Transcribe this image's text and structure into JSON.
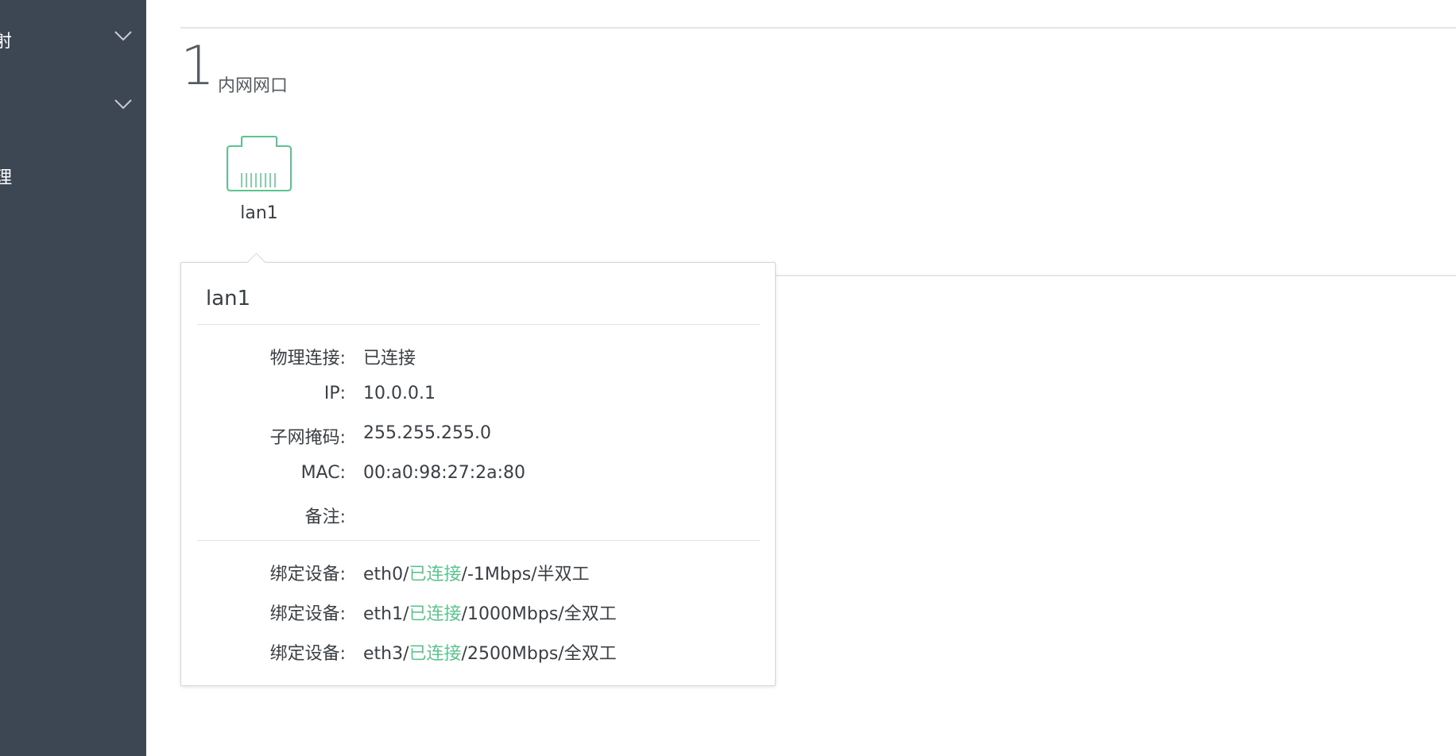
{
  "sidebar": {
    "items": [
      {
        "label": "射"
      },
      {
        "label": ""
      },
      {
        "label": "理"
      }
    ]
  },
  "section": {
    "number": "1",
    "title": "内网网口"
  },
  "port": {
    "name": "lan1"
  },
  "popover": {
    "title": "lan1",
    "fields": [
      {
        "key": "物理连接:",
        "value": "已连接"
      },
      {
        "key": "IP:",
        "value": "10.0.0.1"
      },
      {
        "key": "子网掩码:",
        "value": "255.255.255.0"
      },
      {
        "key": "MAC:",
        "value": "00:a0:98:27:2a:80"
      },
      {
        "key": "备注:",
        "value": ""
      }
    ],
    "bindings": [
      {
        "key": "绑定设备:",
        "dev": "eth0/",
        "status": "已连接",
        "rest": "/-1Mbps/半双工"
      },
      {
        "key": "绑定设备:",
        "dev": "eth1/",
        "status": "已连接",
        "rest": "/1000Mbps/全双工"
      },
      {
        "key": "绑定设备:",
        "dev": "eth3/",
        "status": "已连接",
        "rest": "/2500Mbps/全双工"
      }
    ]
  },
  "colors": {
    "sidebar_bg": "#3d4754",
    "connected": "#5cc48f"
  }
}
